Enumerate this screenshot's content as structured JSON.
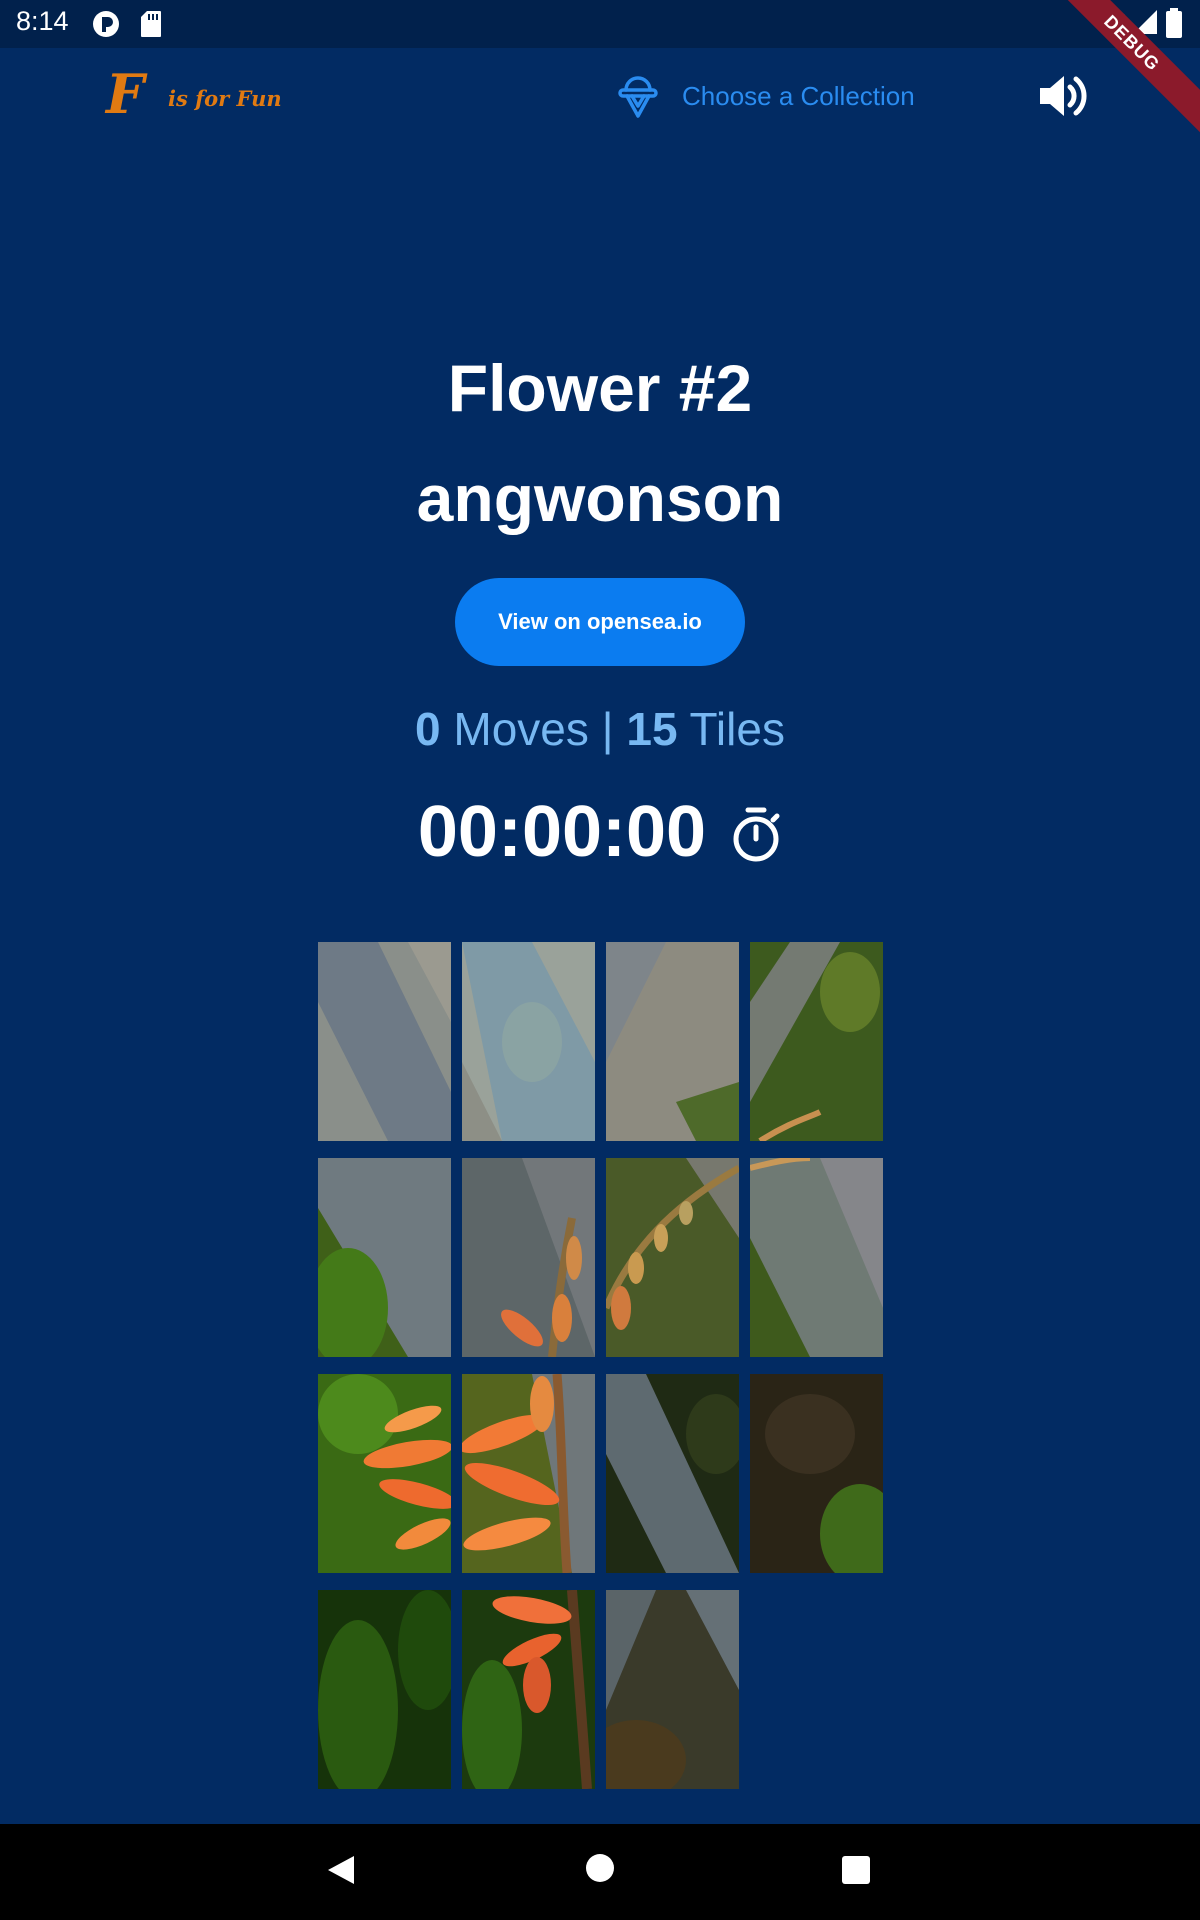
{
  "status_bar": {
    "time": "8:14",
    "icons": [
      "clock-badge-icon",
      "sd-card-icon",
      "wifi-icon",
      "signal-icon",
      "battery-icon"
    ]
  },
  "debug_banner": "DEBUG",
  "app_bar": {
    "logo_letter": "F",
    "logo_text": "is for Fun",
    "collection_label": "Choose a Collection",
    "collection_icon": "ice-cream-icon",
    "volume_icon": "volume-up-icon"
  },
  "nft": {
    "title": "Flower #2",
    "artist": "angwonson"
  },
  "opensea_button": "View on opensea.io",
  "stats": {
    "moves": "0",
    "moves_label": "Moves",
    "separator": "|",
    "tiles": "15",
    "tiles_label": "Tiles"
  },
  "timer": {
    "value": "00:00:00",
    "icon": "stopwatch-icon"
  },
  "puzzle": {
    "rows": 4,
    "cols": 4,
    "tile_count": 15,
    "empty_slot": "row 4, column 4"
  },
  "colors": {
    "background": "#022b63",
    "accent": "#0b7cf0",
    "stats_text": "#78b8f2",
    "logo": "#e07a12"
  },
  "nav_bar": {
    "icons": [
      "back-icon",
      "home-icon",
      "recents-icon"
    ]
  }
}
